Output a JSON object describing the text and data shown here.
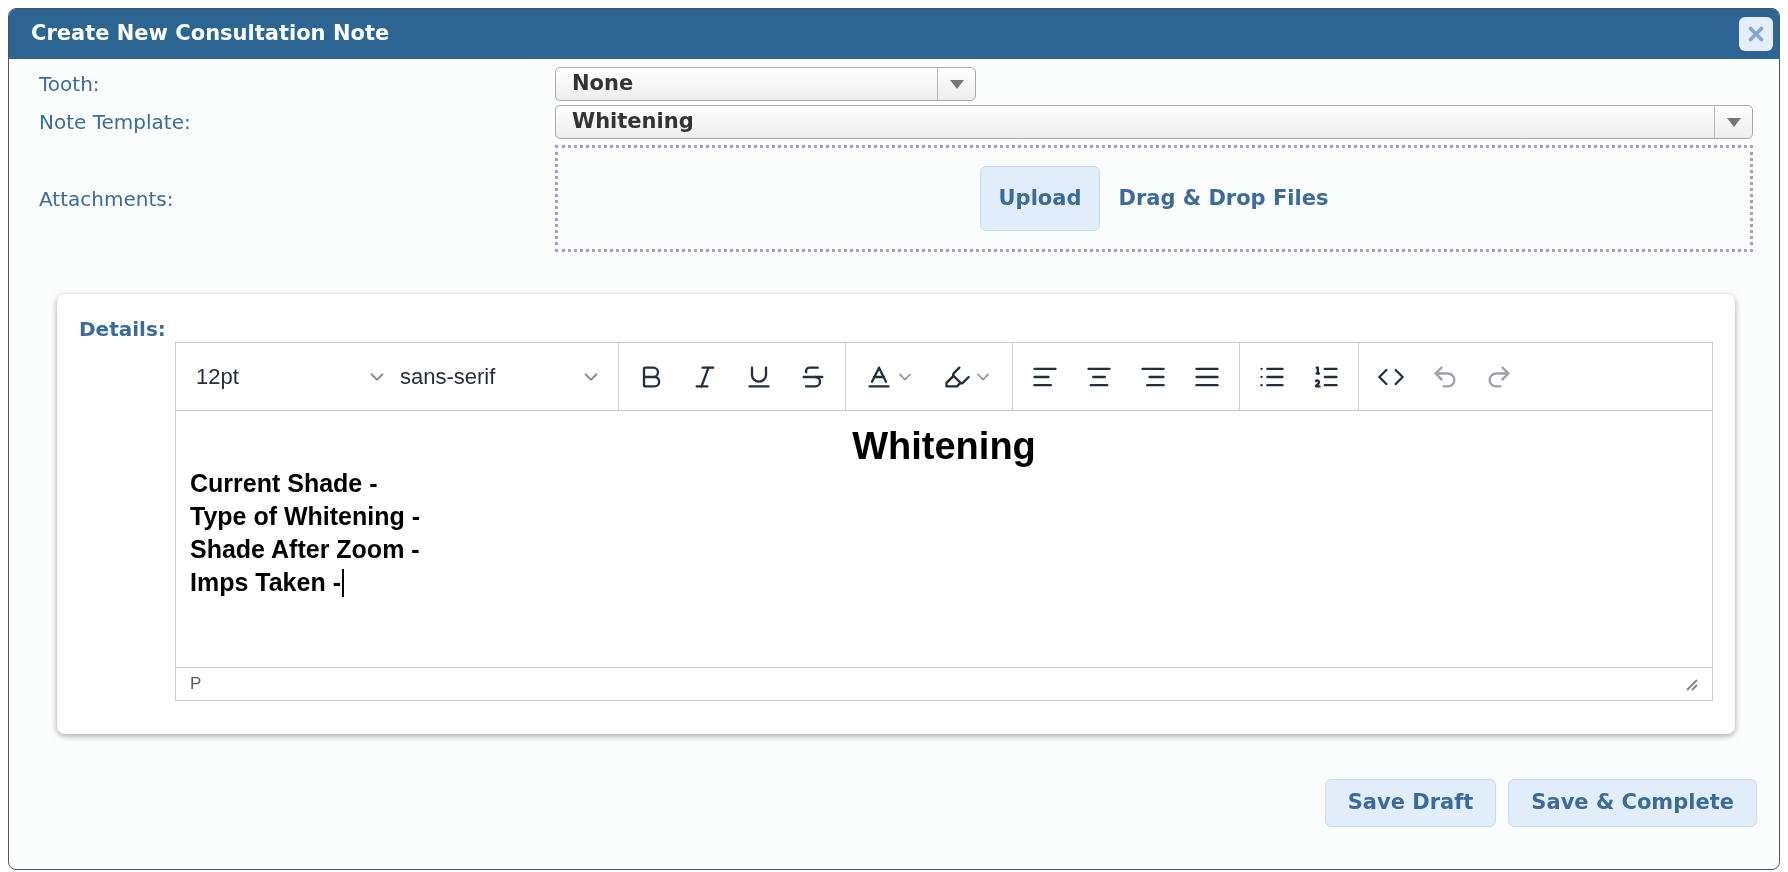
{
  "dialog": {
    "title": "Create New Consultation Note"
  },
  "form": {
    "tooth": {
      "label": "Tooth:",
      "value": "None"
    },
    "note_template": {
      "label": "Note Template:",
      "value": "Whitening"
    },
    "attachments": {
      "label": "Attachments:",
      "upload_button": "Upload",
      "drop_text": "Drag & Drop Files"
    }
  },
  "details": {
    "label": "Details:",
    "toolbar": {
      "font_size": "12pt",
      "font_family": "sans-serif",
      "buttons": [
        {
          "disabled": false
        },
        {
          "disabled": false
        },
        {
          "disabled": false
        },
        {
          "disabled": false
        },
        {
          "disabled": false
        },
        {
          "disabled": false
        },
        {
          "disabled": false
        },
        {
          "disabled": false
        },
        {
          "disabled": false
        },
        {
          "disabled": false
        },
        {
          "disabled": false
        },
        {
          "disabled": false
        },
        {
          "disabled": false
        },
        {
          "disabled": true
        },
        {
          "disabled": true
        }
      ]
    },
    "content": {
      "heading": "Whitening",
      "lines": [
        "Current Shade -",
        "Type of Whitening -",
        "Shade After Zoom -",
        "Imps Taken -"
      ]
    },
    "status_path": "P"
  },
  "buttons": [
    "Save Draft",
    "Save & Complete"
  ]
}
